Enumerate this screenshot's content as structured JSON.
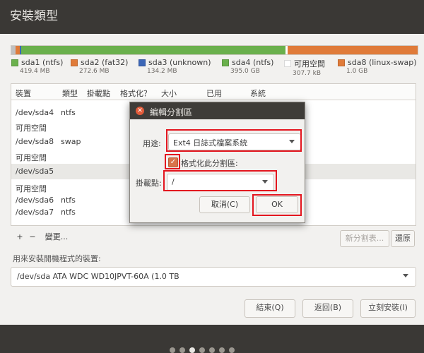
{
  "title": "安裝類型",
  "partition_bar": [
    {
      "name": "sda1 (ntfs)",
      "size": "419.4 MB",
      "color": "#c0c0c0",
      "fraction": 0.01
    },
    {
      "name": "sda2 (fat32)",
      "size": "272.6 MB",
      "color": "#e07b39",
      "fraction": 0.01
    },
    {
      "name": "sda3 (unknown)",
      "size": "134.2 MB",
      "color": "#3b66b6",
      "fraction": 0.005
    },
    {
      "name": "sda4 (ntfs)",
      "size": "395.0 GB",
      "color": "#6ab04c",
      "fraction": 0.65
    },
    {
      "name": "可用空間",
      "size": "307.7 kB",
      "color": "#ffffff",
      "fraction": 0.005
    },
    {
      "name": "sda8 (linux-swap)",
      "size": "1.0 GB",
      "color": "#e07b39",
      "fraction": 0.32
    }
  ],
  "table": {
    "headers": [
      "裝置",
      "類型",
      "掛載點",
      "格式化？",
      "大小",
      "已用",
      "系統"
    ],
    "rows": [
      {
        "device": "/dev/sda4",
        "type": "ntfs"
      },
      {
        "device": "可用空間",
        "type": ""
      },
      {
        "device": "/dev/sda8",
        "type": "swap"
      },
      {
        "device": "可用空間",
        "type": ""
      },
      {
        "device": "/dev/sda5",
        "type": "",
        "selected": true
      },
      {
        "device": "可用空間",
        "type": ""
      },
      {
        "device": "/dev/sda6",
        "type": "ntfs"
      },
      {
        "device": "/dev/sda7",
        "type": "ntfs"
      }
    ]
  },
  "toolbar": {
    "add": "+",
    "remove": "−",
    "change": "變更...",
    "new_table": "新分割表...",
    "revert": "還原"
  },
  "bootloader": {
    "label": "用來安裝開機程式的裝置:",
    "device": "/dev/sda   ATA WDC WD10JPVT-60A (1.0 TB"
  },
  "actions": {
    "quit": "結束(Q)",
    "back": "返回(B)",
    "install": "立刻安裝(I)"
  },
  "dialog": {
    "title": "編輯分割區",
    "use_label": "用途:",
    "use_value": "Ext4 日誌式檔案系統",
    "format_label": "格式化此分割區:",
    "format_checked": true,
    "mount_label": "掛載點:",
    "mount_value": "/",
    "cancel": "取消(C)",
    "ok": "OK"
  }
}
